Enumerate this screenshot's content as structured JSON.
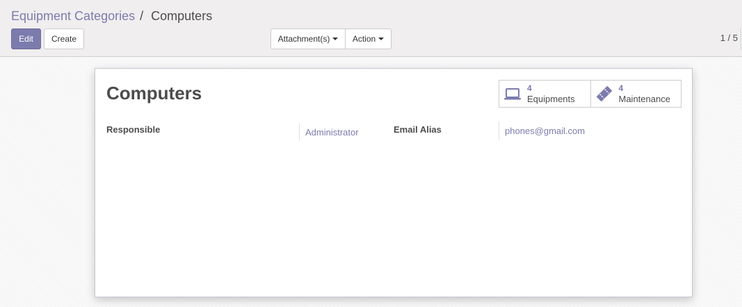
{
  "breadcrumb": {
    "parent": "Equipment Categories",
    "separator": "/",
    "current": "Computers"
  },
  "toolbar": {
    "edit_label": "Edit",
    "create_label": "Create",
    "attachments_label": "Attachment(s)",
    "action_label": "Action"
  },
  "pager": {
    "value": "1 / 5"
  },
  "record": {
    "title": "Computers",
    "smart_buttons": [
      {
        "value": "4",
        "label": "Equipments",
        "icon": "laptop-icon"
      },
      {
        "value": "4",
        "label": "Maintenance",
        "icon": "ticket-icon"
      }
    ],
    "fields": {
      "responsible_label": "Responsible",
      "responsible_value": "Administrator",
      "email_alias_label": "Email Alias",
      "email_alias_value": "phones@gmail.com"
    }
  },
  "colors": {
    "brand": "#7c7bad",
    "text": "#4c4c4c",
    "panel_bg": "#f0eeee"
  }
}
